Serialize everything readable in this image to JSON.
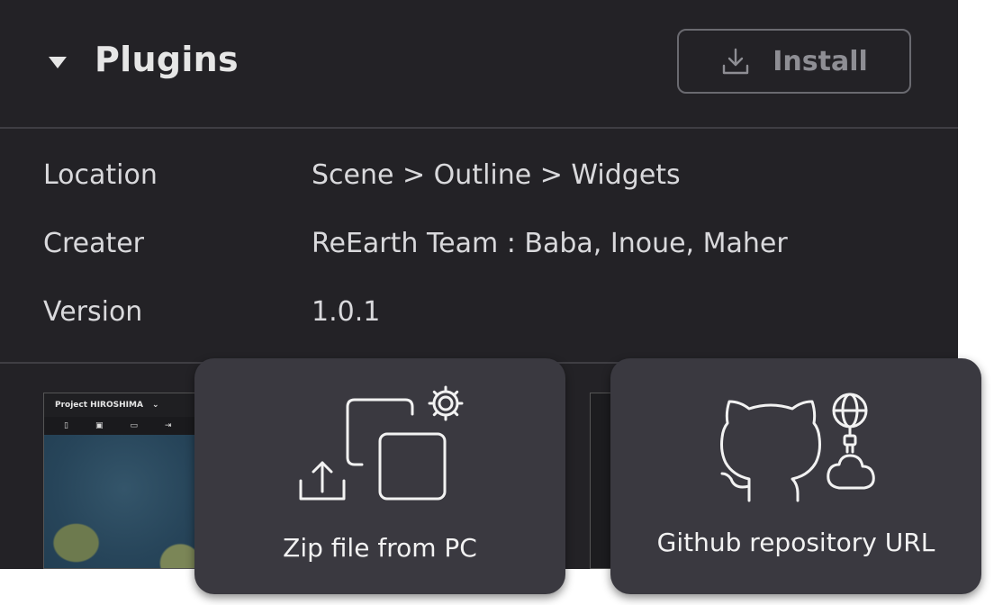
{
  "header": {
    "title": "Plugins",
    "install_label": "Install"
  },
  "info": [
    {
      "label": "Location",
      "value": "Scene > Outline > Widgets"
    },
    {
      "label": "Creater",
      "value": "ReEarth Team : Baba, Inoue, Maher"
    },
    {
      "label": "Version",
      "value": "1.0.1"
    }
  ],
  "preview": {
    "project_title": "Project HIROSHIMA"
  },
  "cards": {
    "zip": "Zip file from PC",
    "github": "Github repository URL"
  }
}
